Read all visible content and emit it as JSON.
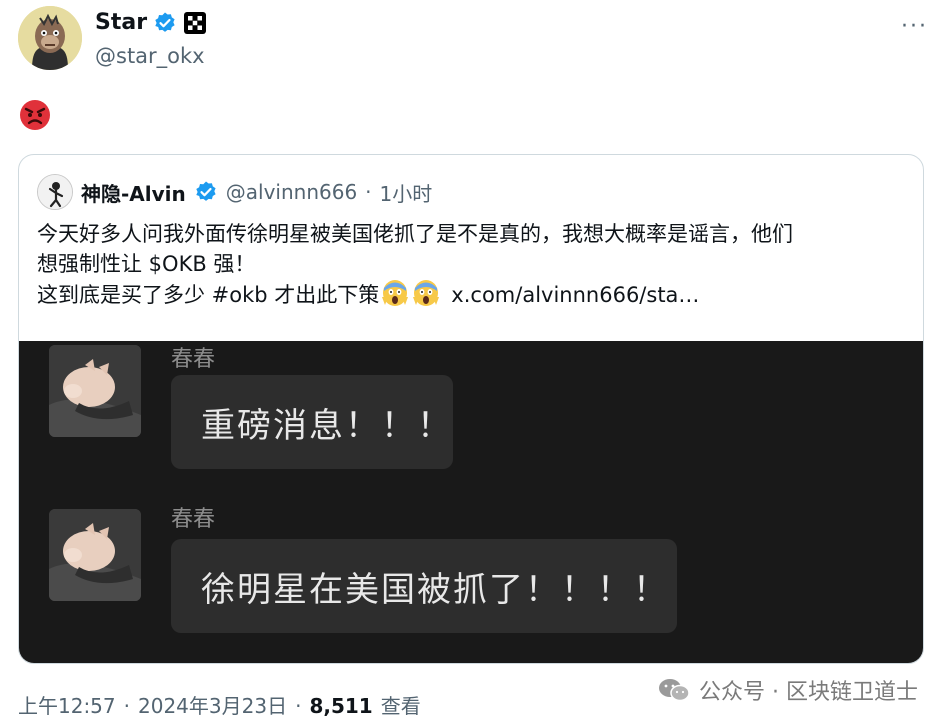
{
  "author": {
    "display_name": "Star",
    "handle": "@star_okx",
    "more_label": "···",
    "avatar_icon": "bored-ape-avatar",
    "verified_icon": "verified-badge-icon",
    "affiliate_icon": "okx-logo-badge"
  },
  "tweet": {
    "body_emoji": "angry-face-emoji"
  },
  "quoted": {
    "display_name": "神隐-Alvin",
    "handle": "@alvinnn666",
    "separator": "·",
    "time": "1小时",
    "line1": "今天好多人问我外面传徐明星被美国佬抓了是不是真的，我想大概率是谣言，他们",
    "line2": "想强制性让 $OKB 强！",
    "line3": "这到底是买了多少 #okb 才出此下策",
    "link": "x.com/alvinnn666/sta…",
    "scream_emoji": "face-screaming-in-fear-emoji",
    "media": {
      "messages": [
        {
          "sender": "春春",
          "text": "重磅消息！！！"
        },
        {
          "sender": "春春",
          "text": "徐明星在美国被抓了！！！！"
        }
      ]
    }
  },
  "footer": {
    "time": "上午12:57",
    "dot1": "·",
    "date": "2024年3月23日",
    "dot2": "·",
    "views_count": "8,511",
    "views_label": "查看"
  },
  "watermark": {
    "text": "公众号 · 区块链卫道士",
    "icon": "wechat-icon"
  },
  "colors": {
    "verified_blue": "#1d9bf0",
    "secondary_text": "#536471",
    "media_bg": "#191919",
    "bubble_bg": "#2d2d2d"
  }
}
